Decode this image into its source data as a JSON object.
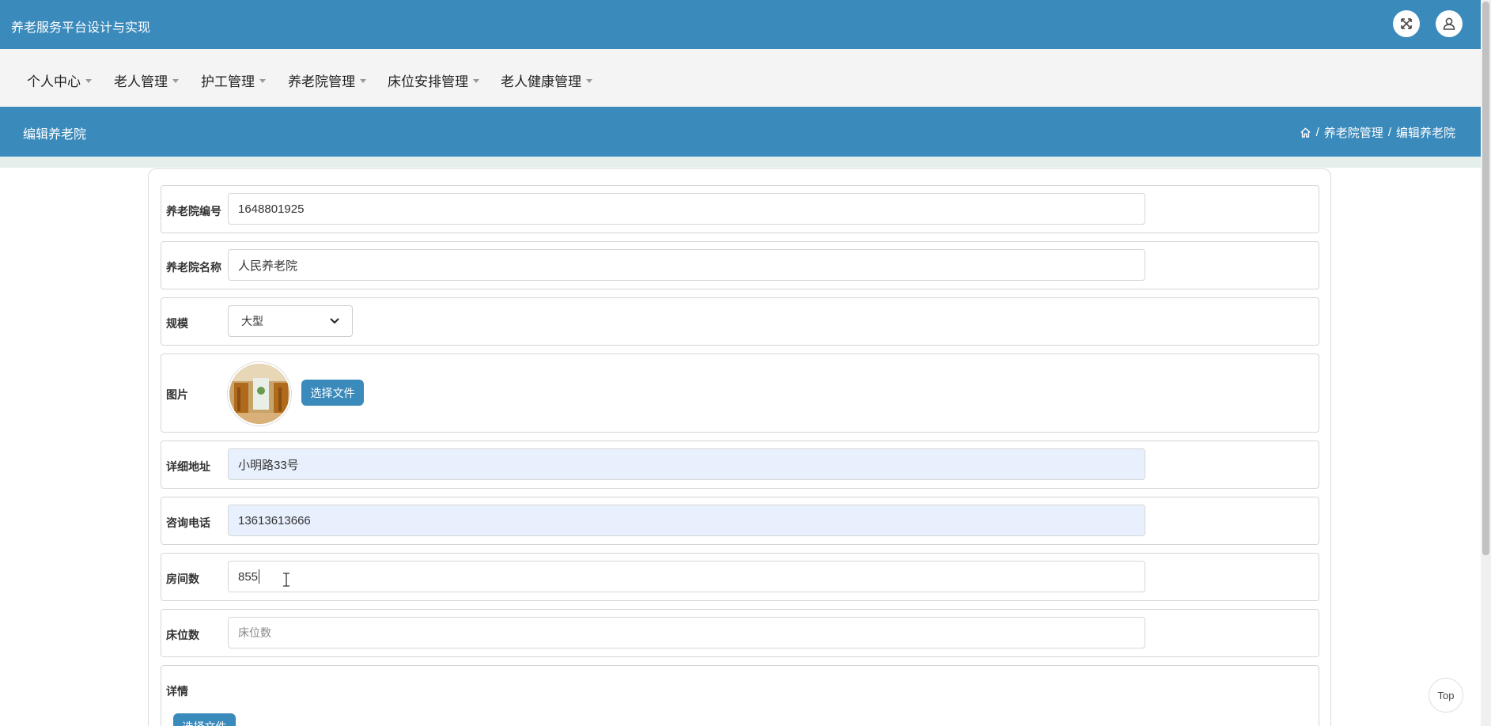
{
  "app": {
    "title": "养老服务平台设计与实现"
  },
  "nav": {
    "items": [
      {
        "label": "个人中心"
      },
      {
        "label": "老人管理"
      },
      {
        "label": "护工管理"
      },
      {
        "label": "养老院管理"
      },
      {
        "label": "床位安排管理"
      },
      {
        "label": "老人健康管理"
      }
    ]
  },
  "header": {
    "page_title": "编辑养老院",
    "breadcrumb": {
      "sep": "/",
      "parent": "养老院管理",
      "current": "编辑养老院"
    }
  },
  "form": {
    "code": {
      "label": "养老院编号",
      "value": "1648801925"
    },
    "name": {
      "label": "养老院名称",
      "value": "人民养老院"
    },
    "scale": {
      "label": "规模",
      "value": "大型"
    },
    "image": {
      "label": "图片",
      "button": "选择文件"
    },
    "address": {
      "label": "详细地址",
      "value": "小明路33号"
    },
    "phone": {
      "label": "咨询电话",
      "value": "13613613666"
    },
    "rooms": {
      "label": "房间数",
      "value": "855"
    },
    "beds": {
      "label": "床位数",
      "placeholder": "床位数"
    },
    "details": {
      "label": "详情",
      "button": "选择文件"
    }
  },
  "top_button": "Top",
  "colors": {
    "primary": "#3b8abc",
    "nav_bg": "#f4f4f4",
    "autofill": "#e8f0fd"
  }
}
